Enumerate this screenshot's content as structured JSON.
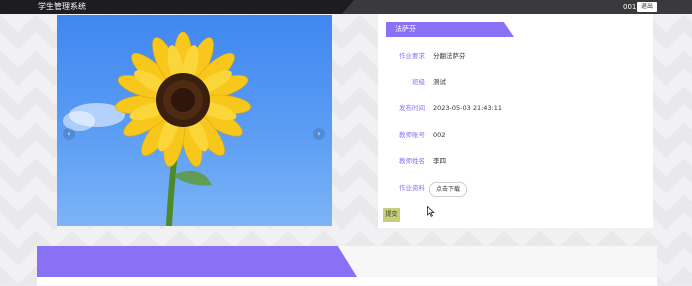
{
  "header": {
    "app_title": "学生管理系统",
    "user_id": "001",
    "logout_label": "退出"
  },
  "carousel": {
    "prev_icon": "‹",
    "next_icon": "›"
  },
  "detail": {
    "ribbon_title": "法萨芬",
    "fields": [
      {
        "label": "作业要求",
        "value": "分翻法萨芬"
      },
      {
        "label": "班级",
        "value": "测试"
      },
      {
        "label": "发布时间",
        "value": "2023-05-03 21:43:11"
      },
      {
        "label": "教师账号",
        "value": "002"
      },
      {
        "label": "教师姓名",
        "value": "李四"
      },
      {
        "label": "作业资料",
        "value": ""
      }
    ],
    "download_label": "点击下载",
    "submit_label": "提交"
  },
  "colors": {
    "accent": "#8a70f5",
    "submit": "#c4d07a",
    "topbar": "#2c2c2f"
  }
}
